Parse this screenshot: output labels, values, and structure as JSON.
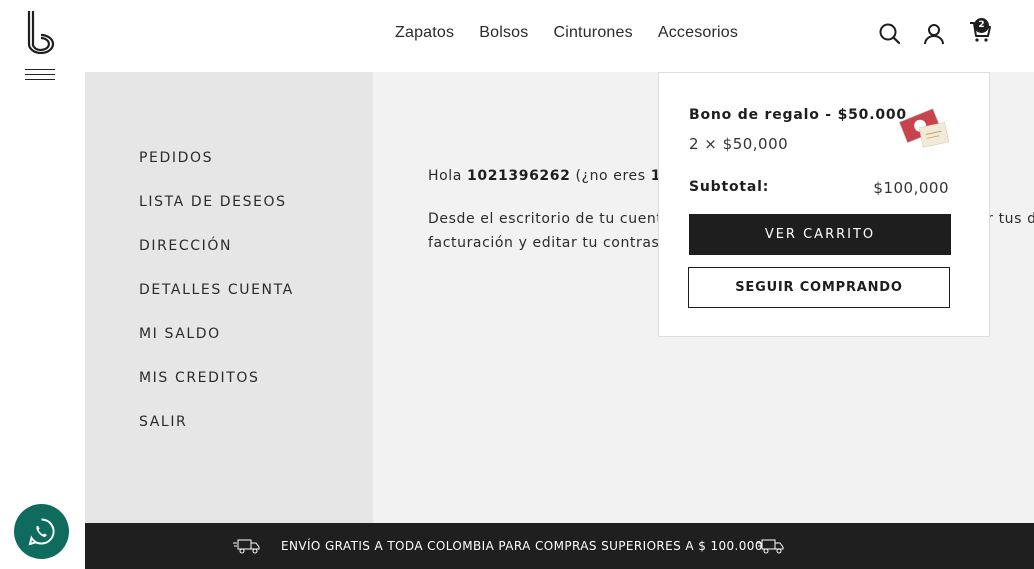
{
  "header": {
    "nav": [
      "Zapatos",
      "Bolsos",
      "Cinturones",
      "Accesorios"
    ],
    "cart_count": "2"
  },
  "sidebar": {
    "items": [
      "PEDIDOS",
      "LISTA DE DESEOS",
      "DIRECCIÓN",
      "DETALLES CUENTA",
      "MI SALDO",
      "MIS CREDITOS",
      "SALIR"
    ]
  },
  "account": {
    "greeting_prefix": "Hola ",
    "username": "1021396262",
    "greeting_mid": " (¿no eres ",
    "username_repeat": "1021",
    "desc_line1": "Desde el escritorio de tu cuent",
    "desc_line1_end": "ar tus d",
    "desc_line2": "facturación y editar tu contras"
  },
  "minicart": {
    "product_name": "Bono de regalo - $50.000",
    "quantity_price": "2 × $50,000",
    "subtotal_label": "Subtotal:",
    "subtotal_value": "$100,000",
    "view_cart": "VER CARRITO",
    "continue_shopping": "SEGUIR COMPRANDO"
  },
  "promo": {
    "text": "ENVÍO GRATIS A TODA COLOMBIA PARA COMPRAS SUPERIORES A $ 100.000"
  },
  "colors": {
    "dark": "#1e1e1e",
    "sidebar_bg": "#e6e6e6",
    "content_bg": "#f2f2f2",
    "whatsapp": "#0f6b5e"
  }
}
